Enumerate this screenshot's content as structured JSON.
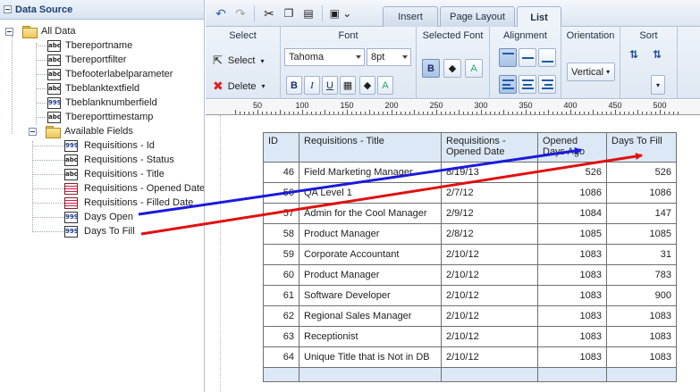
{
  "data_source": {
    "title": "Data Source",
    "root_label": "All Data",
    "root_items": [
      {
        "label": "Tbereportname",
        "icon": "abc"
      },
      {
        "label": "Tbereportfilter",
        "icon": "abc"
      },
      {
        "label": "Tbefooterlabelparameter",
        "icon": "abc"
      },
      {
        "label": "Tbeblanktextfield",
        "icon": "abc"
      },
      {
        "label": "Tbeblanknumberfield",
        "icon": "999"
      },
      {
        "label": "Tbereporttimestamp",
        "icon": "abc"
      }
    ],
    "folder_label": "Available Fields",
    "fields": [
      {
        "label": "Requisitions - Id",
        "icon": "999"
      },
      {
        "label": "Requisitions - Status",
        "icon": "abc"
      },
      {
        "label": "Requisitions - Title",
        "icon": "abc"
      },
      {
        "label": "Requisitions - Opened Date",
        "icon": "date"
      },
      {
        "label": "Requisitions - Filled Date",
        "icon": "date"
      },
      {
        "label": "Days Open",
        "icon": "999"
      },
      {
        "label": "Days To Fill",
        "icon": "999"
      }
    ]
  },
  "tabs": [
    "Insert",
    "Page Layout",
    "List"
  ],
  "active_tab": "List",
  "ribbon": {
    "select": {
      "title": "Select",
      "select_label": "Select",
      "delete_label": "Delete"
    },
    "font": {
      "title": "Font",
      "family": "Tahoma",
      "size": "8pt",
      "bold": "B",
      "italic": "I",
      "underline": "U"
    },
    "selected_font": {
      "title": "Selected Font",
      "bold": "B"
    },
    "alignment": {
      "title": "Alignment"
    },
    "orientation": {
      "title": "Orientation",
      "value": "Vertical"
    },
    "sort": {
      "title": "Sort"
    }
  },
  "ruler": {
    "labels": [
      "50",
      "100",
      "150",
      "200",
      "250",
      "300",
      "350",
      "400",
      "450",
      "500"
    ]
  },
  "table": {
    "headers": [
      "ID",
      "Requisitions - Title",
      "Requisitions - Opened Date",
      "Opened\nDays Ago",
      "Days To Fill"
    ],
    "rows": [
      [
        "46",
        "Field Marketing Manager",
        "8/19/13",
        "526",
        "526"
      ],
      [
        "56",
        "QA Level 1",
        "2/7/12",
        "1086",
        "1086"
      ],
      [
        "57",
        "Admin for the Cool Manager",
        "2/9/12",
        "1084",
        "147"
      ],
      [
        "58",
        "Product Manager",
        "2/8/12",
        "1085",
        "1085"
      ],
      [
        "59",
        "Corporate Accountant",
        "2/10/12",
        "1083",
        "31"
      ],
      [
        "60",
        "Product Manager",
        "2/10/12",
        "1083",
        "783"
      ],
      [
        "61",
        "Software Developer",
        "2/10/12",
        "1083",
        "900"
      ],
      [
        "62",
        "Regional Sales Manager",
        "2/10/12",
        "1083",
        "1083"
      ],
      [
        "63",
        "Receptionist",
        "2/10/12",
        "1083",
        "1083"
      ],
      [
        "64",
        "Unique Title that is Not in DB",
        "2/10/12",
        "1083",
        "1083"
      ]
    ]
  },
  "annotations": {
    "blue_arrow_color": "#1a1adc",
    "red_arrow_color": "#e01010"
  }
}
